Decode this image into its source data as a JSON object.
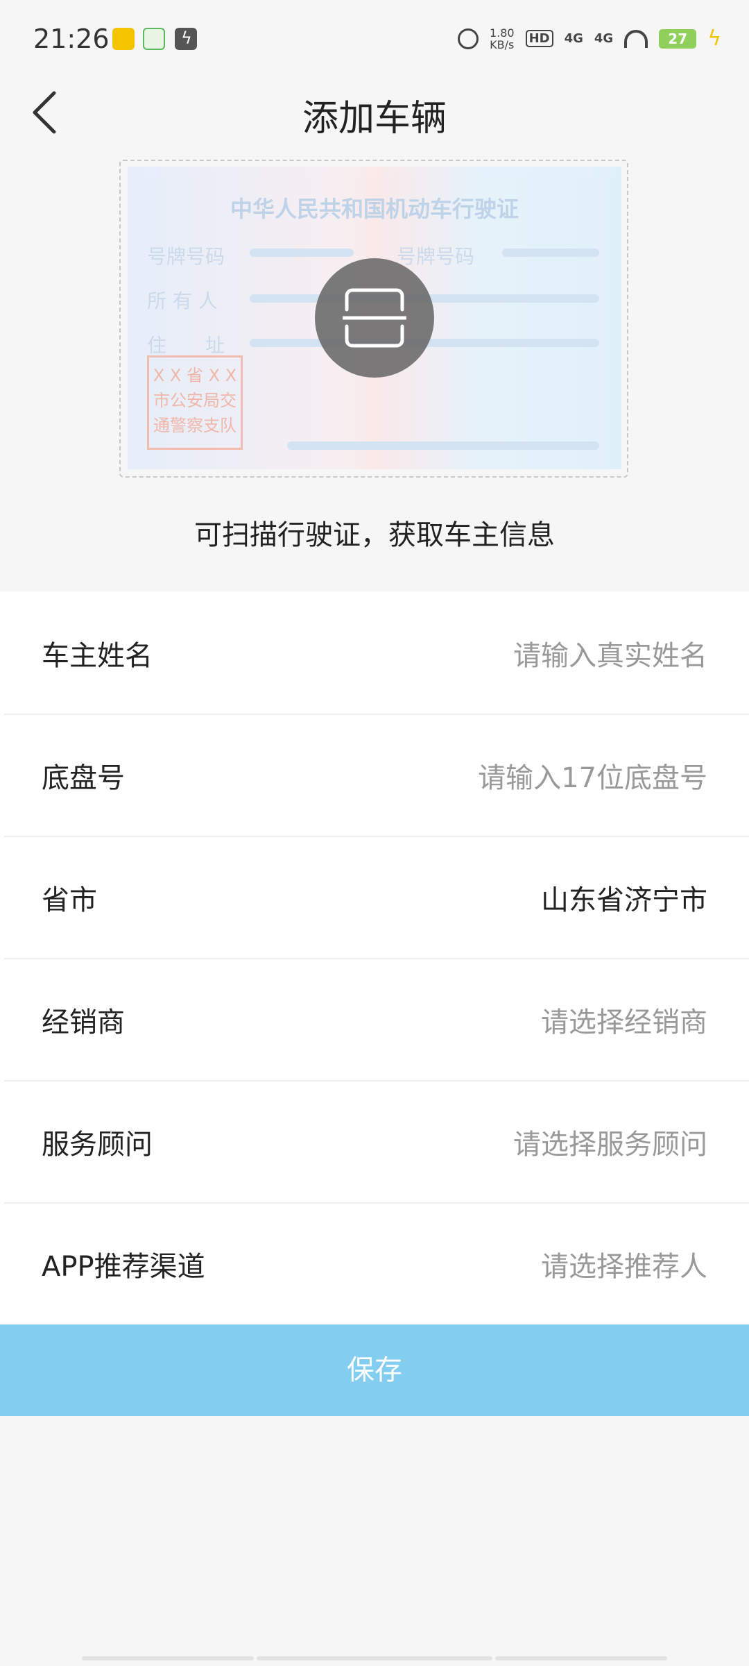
{
  "status_bar": {
    "time": "21:26",
    "speed_value": "1.80",
    "speed_unit": "KB/s",
    "hd_label": "HD",
    "network_1": "4G",
    "network_2": "4G",
    "battery": "27"
  },
  "header": {
    "title": "添加车辆"
  },
  "scan_card": {
    "license_title": "中华人民共和国机动车行驶证",
    "plate_label_1": "号牌号码",
    "plate_label_2": "号牌号码",
    "owner_label": "所 有 人",
    "address_label": "住　　址",
    "stamp_line_1": "X X 省 X X",
    "stamp_line_2": "市公安局交",
    "stamp_line_3": "通警察支队",
    "hint": "可扫描行驶证，获取车主信息"
  },
  "form": {
    "rows": [
      {
        "label": "车主姓名",
        "placeholder": "请输入真实姓名"
      },
      {
        "label": "底盘号",
        "placeholder": "请输入17位底盘号"
      },
      {
        "label": "省市",
        "value": "山东省济宁市"
      },
      {
        "label": "经销商",
        "placeholder": "请选择经销商"
      },
      {
        "label": "服务顾问",
        "placeholder": "请选择服务顾问"
      },
      {
        "label": "APP推荐渠道",
        "placeholder": "请选择推荐人"
      }
    ]
  },
  "save_label": "保存",
  "colors": {
    "save_button": "#82cdf0",
    "placeholder": "#999999",
    "background": "#f6f6f6"
  }
}
